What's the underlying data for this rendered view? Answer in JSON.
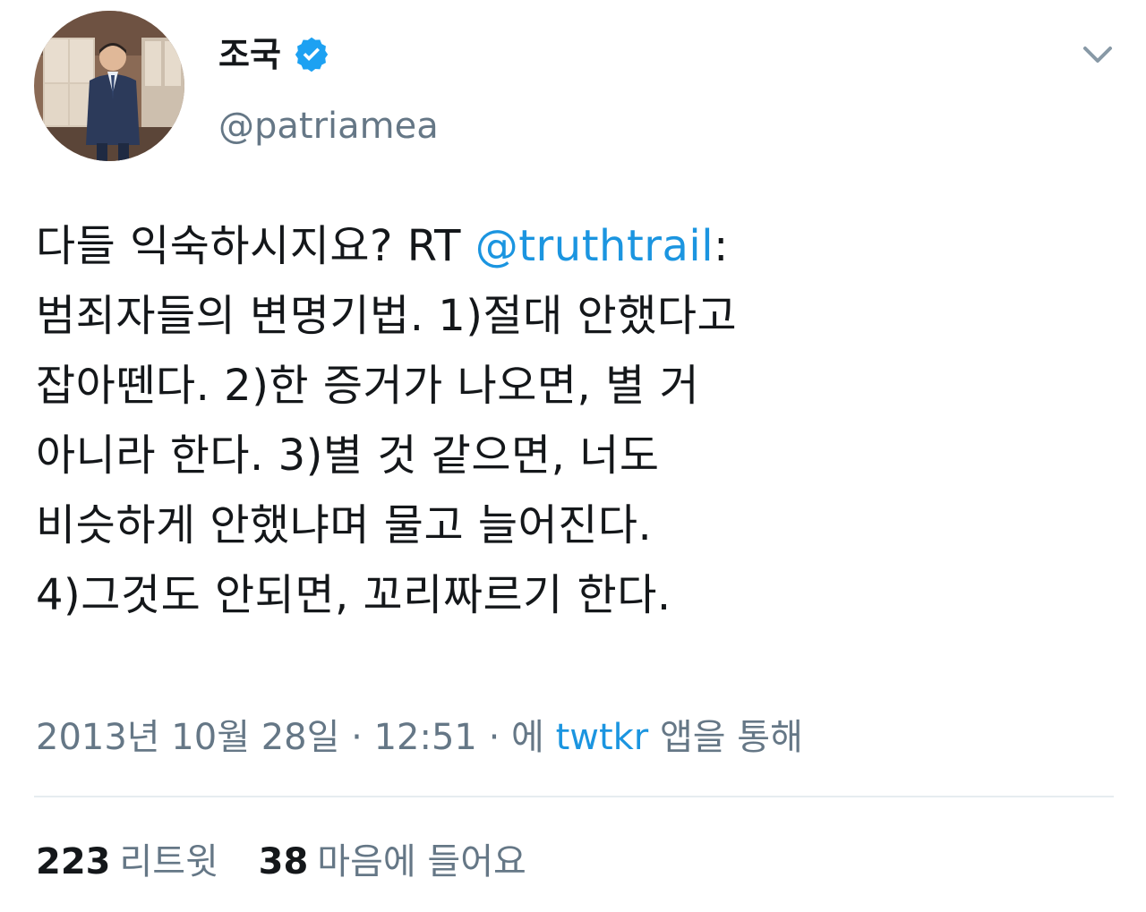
{
  "user": {
    "display_name": "조국",
    "handle": "@patriamea",
    "verified": true,
    "verified_color": "#1da1f2"
  },
  "tweet": {
    "lines": [
      {
        "before": "다들 익숙하시지요? RT ",
        "mention": "@truthtrail",
        "after": ":"
      },
      {
        "text": "범죄자들의 변명기법. 1)절대 안했다고"
      },
      {
        "text": "잡아뗀다. 2)한 증거가 나오면, 별 거"
      },
      {
        "text": "아니라 한다. 3)별 것 같으면, 너도"
      },
      {
        "text": "비슷하게 안했냐며 물고 늘어진다."
      },
      {
        "text": "4)그것도 안되면, 꼬리짜르기 한다."
      }
    ],
    "mention_color": "#1b95e0"
  },
  "meta": {
    "date": "2013년 10월 28일",
    "separator": "·",
    "time": "12:51",
    "via_prefix": "에",
    "source": "twtkr",
    "via_suffix": "앱을 통해"
  },
  "stats": {
    "retweets_count": "223",
    "retweets_label": "리트윗",
    "likes_count": "38",
    "likes_label": "마음에 들어요"
  },
  "icons": {
    "menu": "chevron-down-icon",
    "verified": "verified-badge-icon"
  }
}
